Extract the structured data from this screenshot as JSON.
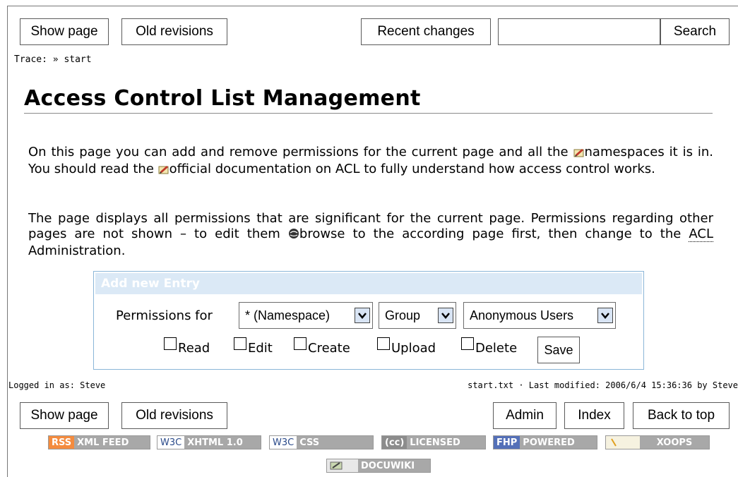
{
  "top_toolbar": {
    "show_page": "Show page",
    "old_revisions": "Old revisions",
    "recent_changes": "Recent changes",
    "search_value": "",
    "search_button": "Search"
  },
  "breadcrumb": {
    "label": "Trace:",
    "separator": "»",
    "page": "start"
  },
  "page_title": "Access Control List Management",
  "intro": {
    "part1": "On this page you can add and remove permissions for the current page and all the",
    "link_namespaces": "namespaces",
    "part2": "it is in. You should read the",
    "link_docs": "official documentation on ACL",
    "part3": "to fully understand how access control works."
  },
  "info": {
    "part1": "The page displays all permissions that are significant for the current page. Permissions regarding other pages are not shown – to edit them",
    "link_browse": "browse",
    "part2": "to the according page first, then change to the",
    "acl_abbr": "ACL",
    "part3": "Administration."
  },
  "acl_form": {
    "heading": "Add new Entry",
    "permissions_for_label": "Permissions for",
    "scope_select": "* (Namespace)",
    "type_select": "Group",
    "who_select": "Anonymous Users",
    "checkboxes": [
      "Read",
      "Edit",
      "Create",
      "Upload",
      "Delete"
    ],
    "save_button": "Save"
  },
  "footer_info": {
    "logged_in": "Logged in as: Steve",
    "last_modified": "start.txt · Last modified: 2006/6/4 15:36:36 by Steve"
  },
  "bottom_toolbar": {
    "show_page": "Show page",
    "old_revisions": "Old revisions",
    "admin": "Admin",
    "index": "Index",
    "back_to_top": "Back to top"
  },
  "badges": {
    "rss": [
      "RSS",
      "XML FEED"
    ],
    "xhtml": [
      "W3C",
      "XHTML 1.0"
    ],
    "css": [
      "W3C",
      "CSS"
    ],
    "cc": [
      "(cc)",
      "LICENSED"
    ],
    "php": [
      "FHP",
      "POWERED"
    ],
    "xoops": [
      "",
      "XOOPS"
    ],
    "dokuwiki": [
      "",
      "DOCUWIKI"
    ]
  },
  "colors": {
    "panel_border": "#8bb6d8",
    "panel_header": "#dbe9f6",
    "select_arrow_bg": "#d8e4f4",
    "rss_orange": "#f48b3e",
    "badge_gray": "#a8a8a8",
    "php_blue": "#5470b8"
  }
}
